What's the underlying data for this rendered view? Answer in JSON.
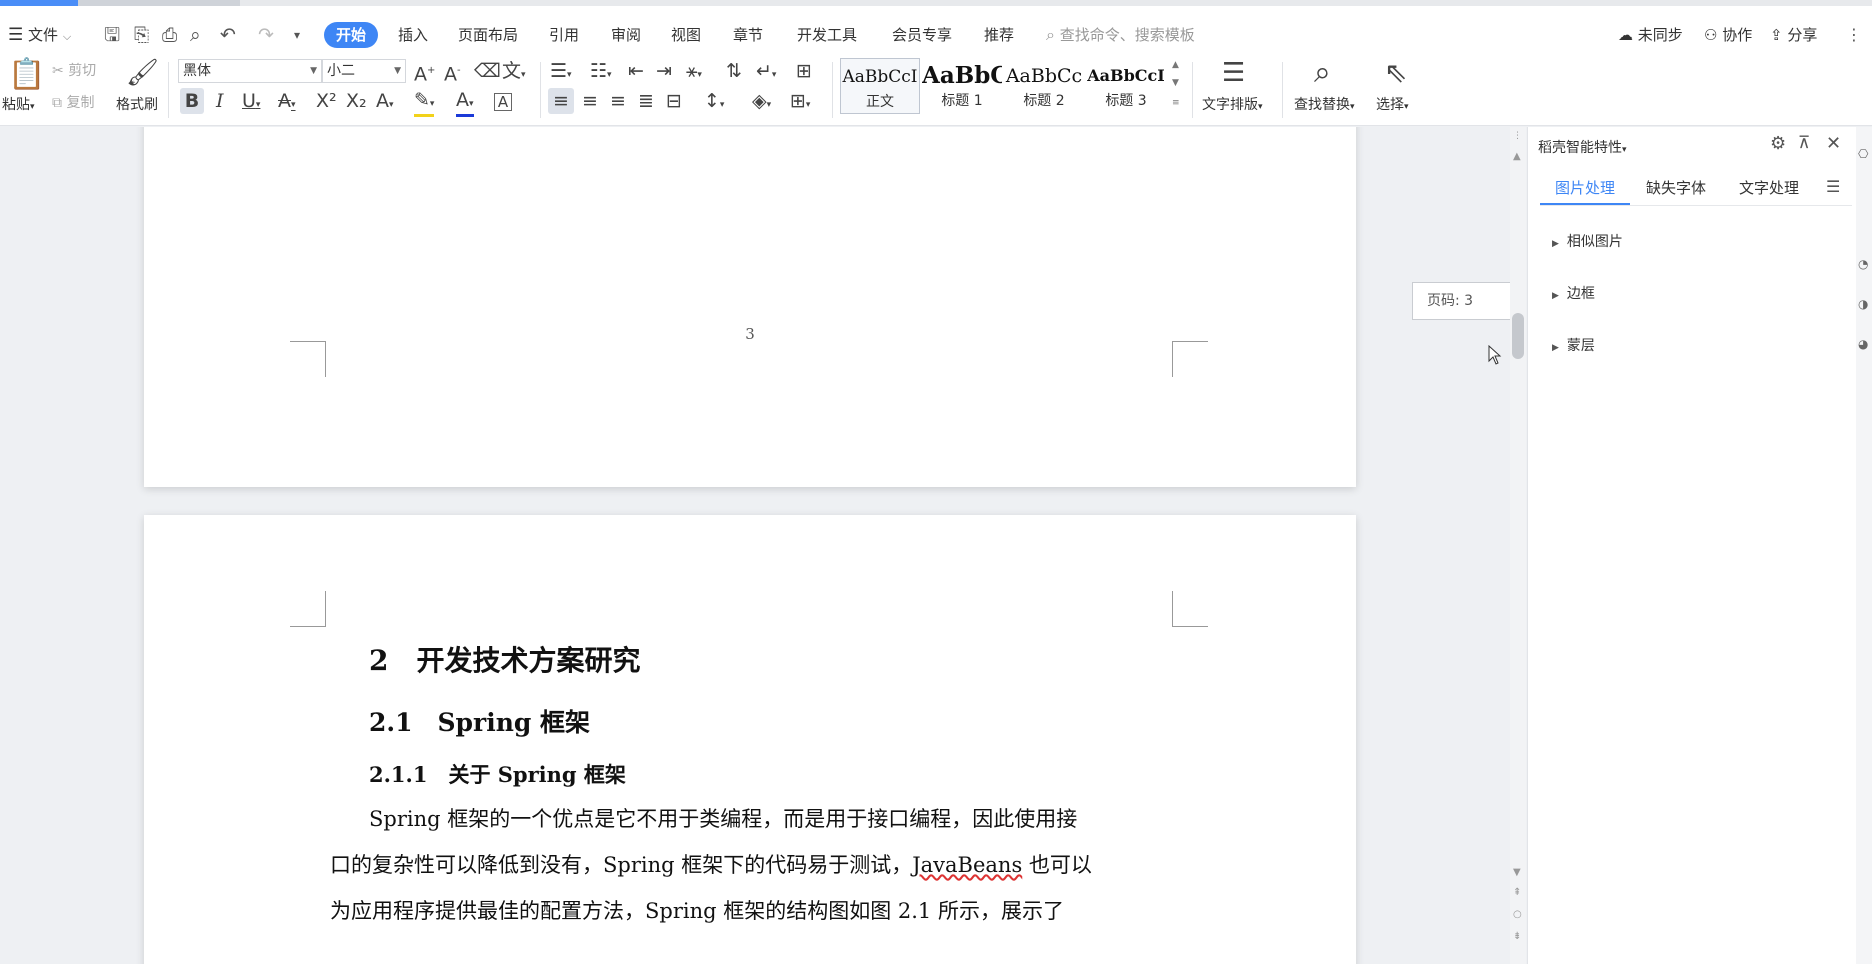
{
  "menu": {
    "file": "文件",
    "tabs": [
      "开始",
      "插入",
      "页面布局",
      "引用",
      "审阅",
      "视图",
      "章节",
      "开发工具",
      "会员专享",
      "推荐"
    ],
    "search_placeholder": "查找命令、搜索模板",
    "sync": "未同步",
    "collab": "协作",
    "share": "分享"
  },
  "ribbon": {
    "paste": "粘贴",
    "cut": "剪切",
    "copy": "复制",
    "format_painter": "格式刷",
    "font_name": "黑体",
    "font_size": "小二",
    "styles": [
      {
        "preview": "AaBbCcI",
        "name": "正文"
      },
      {
        "preview": "AaBbC",
        "name": "标题 1"
      },
      {
        "preview": "AaBbCc",
        "name": "标题 2"
      },
      {
        "preview": "AaBbCcI",
        "name": "标题 3"
      }
    ],
    "text_layout": "文字排版",
    "find_replace": "查找替换",
    "select": "选择"
  },
  "document": {
    "page_number": "3",
    "heading1": "2　开发技术方案研究",
    "heading2": "2.1　Spring 框架",
    "heading3": "2.1.1　关于 Spring 框架",
    "para_line1": "Spring 框架的一个优点是它不用于类编程，而是用于接口编程，因此使用接",
    "para_line2_a": "口的复杂性可以降低到没有，Spring 框架下的代码易于测试，",
    "para_line2_b": "JavaBeans",
    "para_line2_c": " 也可以",
    "para_line3": "为应用程序提供最佳的配置方法，Spring 框架的结构图如图 2.1 所示，展示了"
  },
  "tooltip": "页码: 3",
  "panel": {
    "title": "稻壳智能特性",
    "tabs": [
      "图片处理",
      "缺失字体",
      "文字处理"
    ],
    "items": [
      "相似图片",
      "边框",
      "蒙层"
    ]
  },
  "colors": {
    "accent": "#3e86f5",
    "page": "#ffffff",
    "workspace": "#eef0f3"
  }
}
